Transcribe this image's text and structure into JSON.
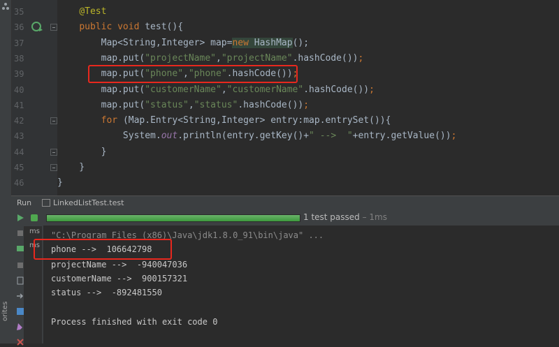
{
  "editor": {
    "lines": [
      {
        "n": "35",
        "segs": [
          {
            "t": "    "
          },
          {
            "t": "@Test",
            "c": "ann"
          }
        ]
      },
      {
        "n": "36",
        "segs": [
          {
            "t": "    "
          },
          {
            "t": "public void ",
            "c": "kw"
          },
          {
            "t": "test(){"
          }
        ]
      },
      {
        "n": "37",
        "segs": [
          {
            "t": "        Map<String,Integer> map="
          },
          {
            "t": "new ",
            "c": "kw newhl"
          },
          {
            "t": "HashMap",
            "c": "newhl"
          },
          {
            "t": "();"
          }
        ]
      },
      {
        "n": "38",
        "segs": [
          {
            "t": "        map.put("
          },
          {
            "t": "\"projectName\"",
            "c": "str"
          },
          {
            "t": ","
          },
          {
            "t": "\"projectName\"",
            "c": "str"
          },
          {
            "t": ".hashCode())"
          },
          {
            "t": ";",
            "c": "kw"
          }
        ]
      },
      {
        "n": "39",
        "segs": [
          {
            "t": "        map.put("
          },
          {
            "t": "\"phone\"",
            "c": "str"
          },
          {
            "t": ","
          },
          {
            "t": "\"phone\"",
            "c": "str"
          },
          {
            "t": ".hashCode())"
          },
          {
            "t": ";",
            "c": "kw"
          }
        ]
      },
      {
        "n": "40",
        "segs": [
          {
            "t": "        map.put("
          },
          {
            "t": "\"customerName\"",
            "c": "str"
          },
          {
            "t": ","
          },
          {
            "t": "\"customerName\"",
            "c": "str"
          },
          {
            "t": ".hashCode())"
          },
          {
            "t": ";",
            "c": "kw"
          }
        ]
      },
      {
        "n": "41",
        "segs": [
          {
            "t": "        map.put("
          },
          {
            "t": "\"status\"",
            "c": "str"
          },
          {
            "t": ","
          },
          {
            "t": "\"status\"",
            "c": "str"
          },
          {
            "t": ".hashCode())"
          },
          {
            "t": ";",
            "c": "kw"
          }
        ]
      },
      {
        "n": "42",
        "segs": [
          {
            "t": "        "
          },
          {
            "t": "for ",
            "c": "kw"
          },
          {
            "t": "(Map.Entry<String,Integer> entry:map.entrySet()){"
          }
        ]
      },
      {
        "n": "43",
        "segs": [
          {
            "t": "            System."
          },
          {
            "t": "out",
            "c": "ital"
          },
          {
            "t": ".println(entry.getKey()+"
          },
          {
            "t": "\" -->  \"",
            "c": "str"
          },
          {
            "t": "+entry.getValue())"
          },
          {
            "t": ";",
            "c": "kw"
          }
        ]
      },
      {
        "n": "44",
        "segs": [
          {
            "t": "        }"
          }
        ]
      },
      {
        "n": "45",
        "segs": [
          {
            "t": "    }"
          }
        ]
      },
      {
        "n": "46",
        "segs": [
          {
            "t": "}"
          }
        ]
      }
    ]
  },
  "run_panel": {
    "label": "Run",
    "tab_name": "LinkedListTest.test",
    "status_text": "1 test passed",
    "duration": " – 1ms",
    "progress": 1.0,
    "tree_items": [
      "ms",
      "ms"
    ]
  },
  "console": {
    "command": "\"C:\\Program Files (x86)\\Java\\jdk1.8.0_91\\bin\\java\" ...",
    "output": [
      "phone -->  106642798",
      "projectName -->  -940047036",
      "customerName -->  900157321",
      "status -->  -892481550",
      "",
      "Process finished with exit code 0"
    ]
  },
  "side_tab_label": "orites",
  "colors": {
    "background": "#2b2b2b",
    "keyword": "#cc7832",
    "string": "#6a8759",
    "annotation": "#bbb529",
    "highlight_box": "#e8281e",
    "progress": "#4fa84f"
  }
}
